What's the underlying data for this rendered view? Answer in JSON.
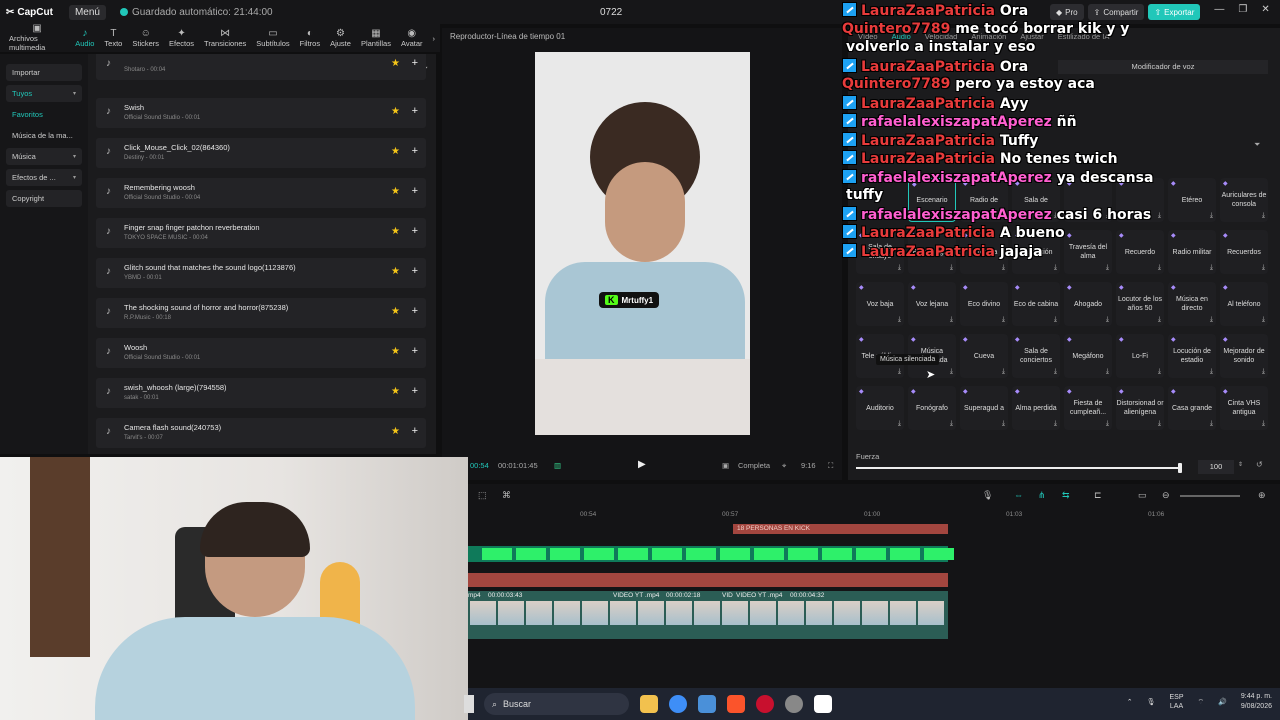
{
  "app": {
    "logo": "CapCut",
    "menu_label": "Menú",
    "autosave_text": "Guardado automático: 21:44:00",
    "project_title": "0722"
  },
  "top_right": {
    "pro_label": "Pro",
    "share_label": "Compartir",
    "export_label": "Exportar"
  },
  "toolbar": {
    "items": [
      {
        "label": "Archivos multimedia",
        "icon": "media-icon"
      },
      {
        "label": "Audio",
        "icon": "audio-icon"
      },
      {
        "label": "Texto",
        "icon": "text-icon"
      },
      {
        "label": "Stickers",
        "icon": "stickers-icon"
      },
      {
        "label": "Efectos",
        "icon": "effects-icon"
      },
      {
        "label": "Transiciones",
        "icon": "transitions-icon"
      },
      {
        "label": "Subtítulos",
        "icon": "subtitles-icon"
      },
      {
        "label": "Filtros",
        "icon": "filters-icon"
      },
      {
        "label": "Ajuste",
        "icon": "adjust-icon"
      },
      {
        "label": "Plantillas",
        "icon": "templates-icon"
      },
      {
        "label": "Avatar",
        "icon": "avatar-icon"
      }
    ],
    "active_index": 1
  },
  "leftnav": {
    "items": [
      {
        "label": "Importar",
        "boxed": true
      },
      {
        "label": "Tuyos",
        "boxed": true,
        "active": true,
        "chevron": true
      },
      {
        "label": "Favoritos",
        "active": true
      },
      {
        "label": "Música de la ma..."
      },
      {
        "label": "Música",
        "boxed": true,
        "chevron": true
      },
      {
        "label": "Efectos de ...",
        "boxed": true,
        "chevron": true
      },
      {
        "label": "Copyright",
        "boxed": true
      }
    ]
  },
  "sound_tabs": [
    "Música",
    "Efectos de sonido",
    "Sonidos de TikTok"
  ],
  "sound_tabs_active": 1,
  "sounds": [
    {
      "name": "",
      "meta": "Shotaro - 00:04"
    },
    {
      "name": "Swish",
      "meta": "Official Sound Studio - 00:01"
    },
    {
      "name": "Click_Mouse_Click_02(864360)",
      "meta": "Destiny - 00:01"
    },
    {
      "name": "Remembering woosh",
      "meta": "Official Sound Studio - 00:04"
    },
    {
      "name": "Finger snap finger patchon reverberation",
      "meta": "TOKYO SPACE MUSIC - 00:04"
    },
    {
      "name": "Glitch sound that matches the sound logo(1123876)",
      "meta": "YBMD - 00:01"
    },
    {
      "name": "The shocking sound of horror and horror(875238)",
      "meta": "R.P.Music - 00:18"
    },
    {
      "name": "Woosh",
      "meta": "Official Sound Studio - 00:01"
    },
    {
      "name": "swish_whoosh (large)(794558)",
      "meta": "satak - 00:01"
    },
    {
      "name": "Camera flash sound(240753)",
      "meta": "Tarvit's - 00:07"
    }
  ],
  "player": {
    "title": "Reproductor-Línea de tiempo 01",
    "overlay_tag": "Mrtuffy1",
    "current_time": "00:54",
    "total_time": "00:01:01:45",
    "mode_label": "Completa",
    "ratio_label": "9:16"
  },
  "right_panel": {
    "tabs": [
      "Vídeo",
      "Audio",
      "Velocidad",
      "Animación",
      "Ajustar",
      "Estilizado de IA"
    ],
    "active_tab": 1,
    "section_title": "Modificador de voz",
    "tooltip": "Música silenciada",
    "voices": [
      "Escenario",
      "Radio de",
      "Sala de",
      "",
      "",
      "Etéreo",
      "Auriculares de consola",
      "Sala de ensayo",
      "Bajo el agua",
      "Armonía",
      "Habitación",
      "Travesía del alma",
      "Recuerdo",
      "Radio militar",
      "Recuerdos",
      "Voz baja",
      "Voz lejana",
      "Eco divino",
      "Eco de cabina",
      "Ahogado",
      "Locutor de los años 50",
      "Música en directo",
      "Al teléfono",
      "Tele público",
      "Música silenciada",
      "Cueva",
      "Sala de conciertos",
      "Megáfono",
      "Lo-Fi",
      "Locución de estadio",
      "Mejorador de sonido",
      "Auditorio",
      "Fonógrafo",
      "Superagud a",
      "Alma perdida",
      "Fiesta de cumpleañ...",
      "Distorsionad or alienígena",
      "Casa grande",
      "Cinta VHS antigua"
    ],
    "strength_label": "Fuerza",
    "strength_value": "100",
    "strength_fraction": 1.0
  },
  "chat": [
    {
      "user": "LauraZaaPatricia",
      "msg": "Ora",
      "badge": true,
      "color": "laura"
    },
    {
      "user": "Quintero7789",
      "msg": "me tocó borrar kik y y",
      "badge": false,
      "color": "quin"
    },
    {
      "user": "",
      "msg": "volverlo a instalar y eso",
      "badge": false,
      "color": "none"
    },
    {
      "user": "LauraZaaPatricia",
      "msg": "Ora",
      "badge": true,
      "color": "laura"
    },
    {
      "user": "Quintero7789",
      "msg": "pero ya estoy aca",
      "badge": false,
      "color": "quin"
    },
    {
      "user": "LauraZaaPatricia",
      "msg": "Ayy",
      "badge": true,
      "color": "laura"
    },
    {
      "user": "rafaelalexiszapatAperez",
      "msg": "ññ",
      "badge": true,
      "color": "rafa"
    },
    {
      "user": "LauraZaaPatricia",
      "msg": "Tuffy",
      "badge": true,
      "color": "laura"
    },
    {
      "user": "LauraZaaPatricia",
      "msg": "No tenes twich",
      "badge": true,
      "color": "laura"
    },
    {
      "user": "rafaelalexiszapatAperez",
      "msg": "ya descansa",
      "badge": true,
      "color": "rafa"
    },
    {
      "user": "",
      "msg": "tuffy",
      "badge": false,
      "color": "none"
    },
    {
      "user": "rafaelalexiszapatAperez",
      "msg": "casi 6 horas",
      "badge": true,
      "color": "rafa"
    },
    {
      "user": "LauraZaaPatricia",
      "msg": "A bueno",
      "badge": true,
      "color": "laura"
    },
    {
      "user": "LauraZaaPatricia",
      "msg": "jajaja",
      "badge": true,
      "color": "laura"
    }
  ],
  "timeline": {
    "ruler": [
      "00:54",
      "00:57",
      "01:00",
      "01:03",
      "01:06"
    ],
    "red_clip_label": "18 PERSONAS EN KICK",
    "video_labels": [
      "mp4",
      "00:00:03:43",
      "VIDEO YT .mp4",
      "00:00:02:18",
      "VID",
      "VIDEO YT .mp4",
      "00:00:04:32"
    ]
  },
  "taskbar": {
    "search_placeholder": "Buscar",
    "lang_top": "ESP",
    "lang_bottom": "LAA",
    "time": "9:44 p. m.",
    "date": "9/08/2026"
  },
  "colors": {
    "accent": "#21c7b9",
    "laura": "#e83b3b",
    "quin": "#e83b3b",
    "rafa": "#ff5fd0",
    "kick_green": "#53fc18"
  }
}
